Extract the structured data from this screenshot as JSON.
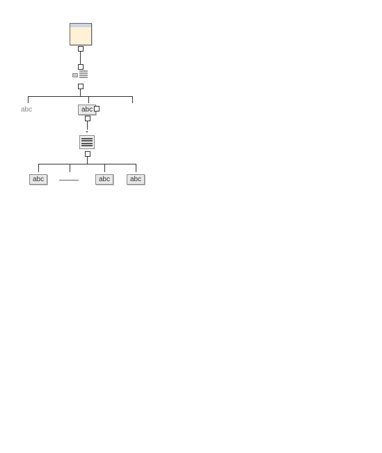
{
  "tree": {
    "leaf_plain": "abc",
    "child_boxed": "abc",
    "grandchildren": [
      "abc",
      "abc",
      "abc"
    ]
  },
  "icons": {
    "root": "window-icon",
    "level1": "toolbar-icon",
    "level3": "list-icon"
  }
}
